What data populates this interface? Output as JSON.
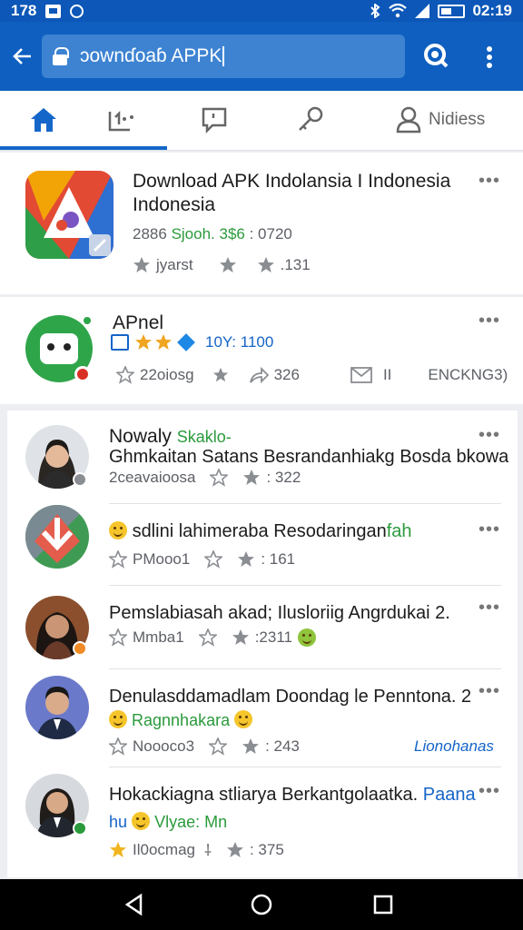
{
  "status_bar": {
    "left_text": "178",
    "time": "02:19"
  },
  "search": {
    "value": "ɔownɗoaɓ APPK"
  },
  "tabs": [
    {
      "icon": "home-icon",
      "label": ""
    },
    {
      "icon": "folder-icon",
      "label": ""
    },
    {
      "icon": "chat-icon",
      "label": ""
    },
    {
      "icon": "key-icon",
      "label": ""
    },
    {
      "icon": "person-icon",
      "label": "Nidiess"
    }
  ],
  "card1": {
    "title_line1": "Download APK Indolansia I Indonesia",
    "title_line2": "Indonesia",
    "meta_prefix": "2886",
    "meta_green": "Sjooh. 3$6",
    "meta_suffix": ": 0720",
    "stat1": "jyarst",
    "stat3": ".131"
  },
  "card2": {
    "title": "APnel",
    "rating_text": "10Y: 1100",
    "stat1": "22oiosg",
    "stat2": "326",
    "stat3": "II",
    "stat4": "ENCKNG3)"
  },
  "list": [
    {
      "name": "Nowaly",
      "tag": "Skaklo-",
      "text": "Ghmkaitan Satans Besrandanhiakg Bosda bkowah",
      "stat1": "2ceavaioosa",
      "stat2": ": 322"
    },
    {
      "text": "sdlini lahimeraba Resodaringan",
      "text_tail": "fah",
      "stat1": "PMooo1",
      "stat2": ": 161"
    },
    {
      "text": "Pemslabiasah akad; Ilusloriig Angrdukai 2.",
      "stat1": "Mmba1",
      "stat2": ":2311"
    },
    {
      "text": "Denulasddamadlam Doondag le Penntona.  2",
      "subtext": "Ragnnhakara",
      "stat1": "Noooco3",
      "stat2": ": 243",
      "link": "Lionohanas"
    },
    {
      "text": "Hokackiagna stliarya Berkantgolaatka.",
      "text_tail": "Paana",
      "subtext_prefix": "hu",
      "subtext": "Vlyae: Mn",
      "stat1": "Il0ocmag",
      "stat2": ": 375"
    }
  ],
  "colors": {
    "primary": "#0e5fc0",
    "accent": "#1467c9",
    "green": "#2b9a3c",
    "star": "#f0b521"
  }
}
